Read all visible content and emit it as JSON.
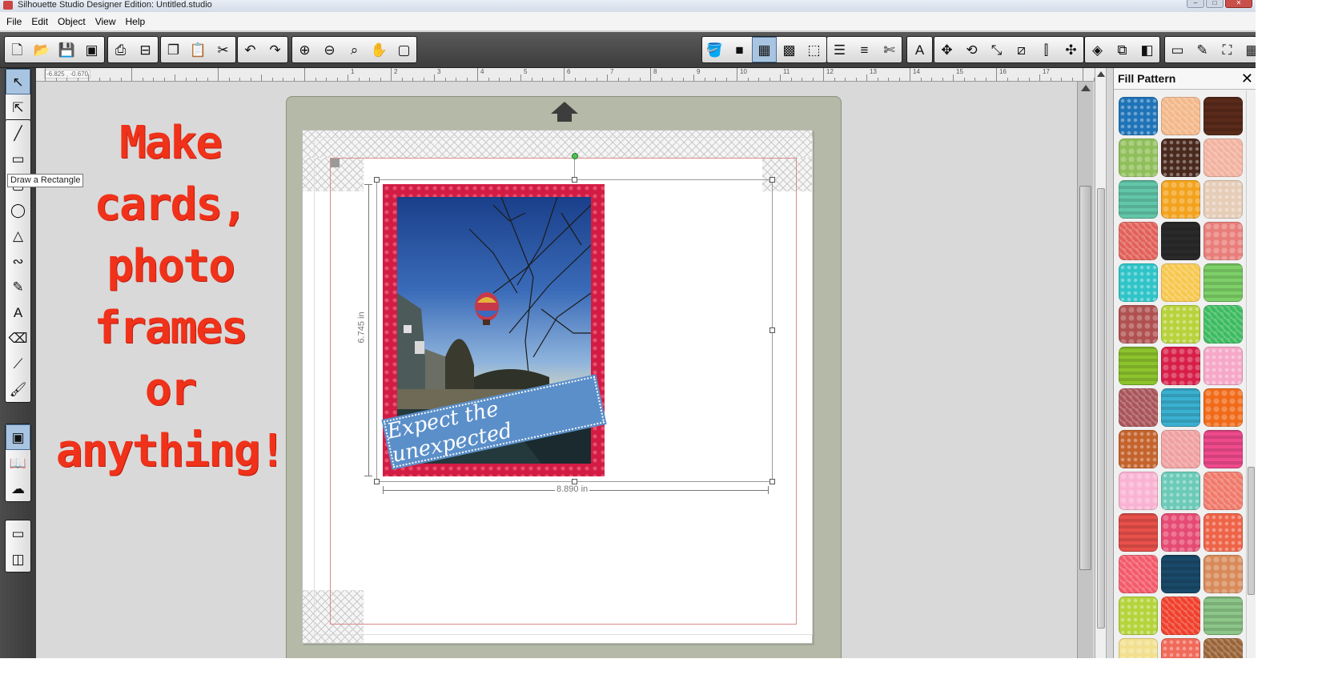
{
  "window": {
    "title": "Silhouette Studio Designer Edition: Untitled.studio",
    "controls": [
      "‒",
      "□",
      "✕"
    ]
  },
  "menu": [
    "File",
    "Edit",
    "Object",
    "View",
    "Help"
  ],
  "ruler": {
    "coordinates": "-6.825 , -0.670",
    "numbers": [
      "1",
      "2",
      "3",
      "4",
      "5",
      "6",
      "7",
      "8",
      "9",
      "10",
      "11",
      "12",
      "13",
      "14",
      "15",
      "16",
      "17"
    ]
  },
  "toolbar": {
    "groups": [
      [
        {
          "icon": "new-page-icon",
          "glyph": "🗋"
        },
        {
          "icon": "open-folder-icon",
          "glyph": "📂"
        },
        {
          "icon": "save-icon",
          "glyph": "💾"
        },
        {
          "icon": "save-sd-icon",
          "glyph": "▣"
        }
      ],
      [
        {
          "icon": "print-icon",
          "glyph": "⎙"
        },
        {
          "icon": "cutter-icon",
          "glyph": "⊟"
        }
      ],
      [
        {
          "icon": "copy-icon",
          "glyph": "❐"
        },
        {
          "icon": "paste-icon",
          "glyph": "📋"
        },
        {
          "icon": "cut-scissors-icon",
          "glyph": "✂"
        }
      ],
      [
        {
          "icon": "undo-icon",
          "glyph": "↶"
        },
        {
          "icon": "redo-icon",
          "glyph": "↷"
        }
      ],
      [
        {
          "icon": "zoom-in-icon",
          "glyph": "⊕"
        },
        {
          "icon": "zoom-out-icon",
          "glyph": "⊖"
        },
        {
          "icon": "zoom-select-icon",
          "glyph": "⌕"
        },
        {
          "icon": "pan-hand-icon",
          "glyph": "✋"
        },
        {
          "icon": "fit-page-icon",
          "glyph": "▢"
        }
      ],
      [
        {
          "icon": "fill-bucket-icon",
          "glyph": "🪣"
        },
        {
          "icon": "fill-color-icon",
          "glyph": "■"
        },
        {
          "icon": "fill-pattern-icon",
          "glyph": "▦",
          "active": true
        },
        {
          "icon": "fill-gradient-icon",
          "glyph": "▩"
        },
        {
          "icon": "line-color-icon",
          "glyph": "⬚"
        }
      ],
      [
        {
          "icon": "line-style-icon",
          "glyph": "☰"
        },
        {
          "icon": "line-weight-icon",
          "glyph": "≡"
        },
        {
          "icon": "cut-settings-icon",
          "glyph": "✄"
        }
      ],
      [
        {
          "icon": "text-style-icon",
          "glyph": "A"
        }
      ],
      [
        {
          "icon": "move-icon",
          "glyph": "✥"
        },
        {
          "icon": "rotate-icon",
          "glyph": "⟲"
        },
        {
          "icon": "scale-icon",
          "glyph": "⤡"
        },
        {
          "icon": "shear-icon",
          "glyph": "⧄"
        },
        {
          "icon": "align-icon",
          "glyph": "⫿"
        },
        {
          "icon": "replicate-icon",
          "glyph": "✣"
        }
      ],
      [
        {
          "icon": "modify-icon",
          "glyph": "◈"
        },
        {
          "icon": "offset-icon",
          "glyph": "⧉"
        },
        {
          "icon": "trace-icon",
          "glyph": "◧"
        }
      ],
      [
        {
          "icon": "page-setup-icon",
          "glyph": "▭"
        },
        {
          "icon": "sketch-icon",
          "glyph": "✎"
        },
        {
          "icon": "fullscreen-icon",
          "glyph": "⛶"
        },
        {
          "icon": "grid-icon",
          "glyph": "▦"
        }
      ]
    ]
  },
  "sidetools": {
    "groups": [
      [
        {
          "icon": "select-arrow-icon",
          "glyph": "↖",
          "active": true
        },
        {
          "icon": "edit-points-icon",
          "glyph": "⇱"
        }
      ],
      [
        {
          "icon": "draw-line-icon",
          "glyph": "╱"
        },
        {
          "icon": "draw-rectangle-icon",
          "glyph": "▭"
        },
        {
          "icon": "rounded-rectangle-icon",
          "glyph": "▢"
        },
        {
          "icon": "draw-ellipse-icon",
          "glyph": "◯"
        },
        {
          "icon": "draw-polygon-icon",
          "glyph": "△"
        },
        {
          "icon": "curve-icon",
          "glyph": "∾"
        },
        {
          "icon": "freehand-pencil-icon",
          "glyph": "✎"
        },
        {
          "icon": "text-tool-icon",
          "glyph": "A"
        },
        {
          "icon": "eraser-icon",
          "glyph": "⌫"
        },
        {
          "icon": "knife-icon",
          "glyph": "⟋"
        },
        {
          "icon": "paint-brush-icon",
          "glyph": "🖌"
        }
      ],
      [
        {
          "icon": "shapes-library-icon",
          "glyph": "▣",
          "active": true
        },
        {
          "icon": "library-book-icon",
          "glyph": "📖"
        },
        {
          "icon": "online-store-icon",
          "glyph": "☁"
        }
      ],
      [
        {
          "icon": "design-view-icon",
          "glyph": "▭"
        },
        {
          "icon": "split-view-icon",
          "glyph": "◫"
        }
      ]
    ],
    "tooltip": "Draw a Rectangle"
  },
  "canvas": {
    "overlay_text": [
      "Make",
      "cards,",
      "photo",
      "frames",
      "or",
      "anything!"
    ],
    "tag_text": "Expect the unexpected",
    "height_label": "6.745 in",
    "width_label": "8.890 in"
  },
  "panel": {
    "title": "Fill Pattern",
    "close": "✕",
    "swatches": [
      [
        "#1f73b8",
        "#f3b88a",
        "#5a2a1a"
      ],
      [
        "#8fbf5a",
        "#4a2a1e",
        "#f2b3a0"
      ],
      [
        "#62c7a8",
        "#f3a21c",
        "#e6cdb8"
      ],
      [
        "#e2615a",
        "#2a2a2a",
        "#e87e7a"
      ],
      [
        "#2fc4c8",
        "#f7c84f",
        "#7dd068"
      ],
      [
        "#b05050",
        "#b8d23c",
        "#3dbb60"
      ],
      [
        "#8dc32c",
        "#d81e48",
        "#f6a8c8"
      ],
      [
        "#a9555a",
        "#3ab0d0",
        "#f06a18"
      ],
      [
        "#c4632c",
        "#f0a0a0",
        "#ef4a8c"
      ],
      [
        "#f9b2d2",
        "#6ccab8",
        "#f07a6a"
      ],
      [
        "#e8504a",
        "#e54a72",
        "#ee6448"
      ],
      [
        "#f35a6a",
        "#1a4a6a",
        "#d88a5a"
      ],
      [
        "#b4d43c",
        "#f0402c",
        "#8cc688"
      ],
      [
        "#f2e090",
        "#f06a5a",
        "#9a6438"
      ]
    ]
  }
}
